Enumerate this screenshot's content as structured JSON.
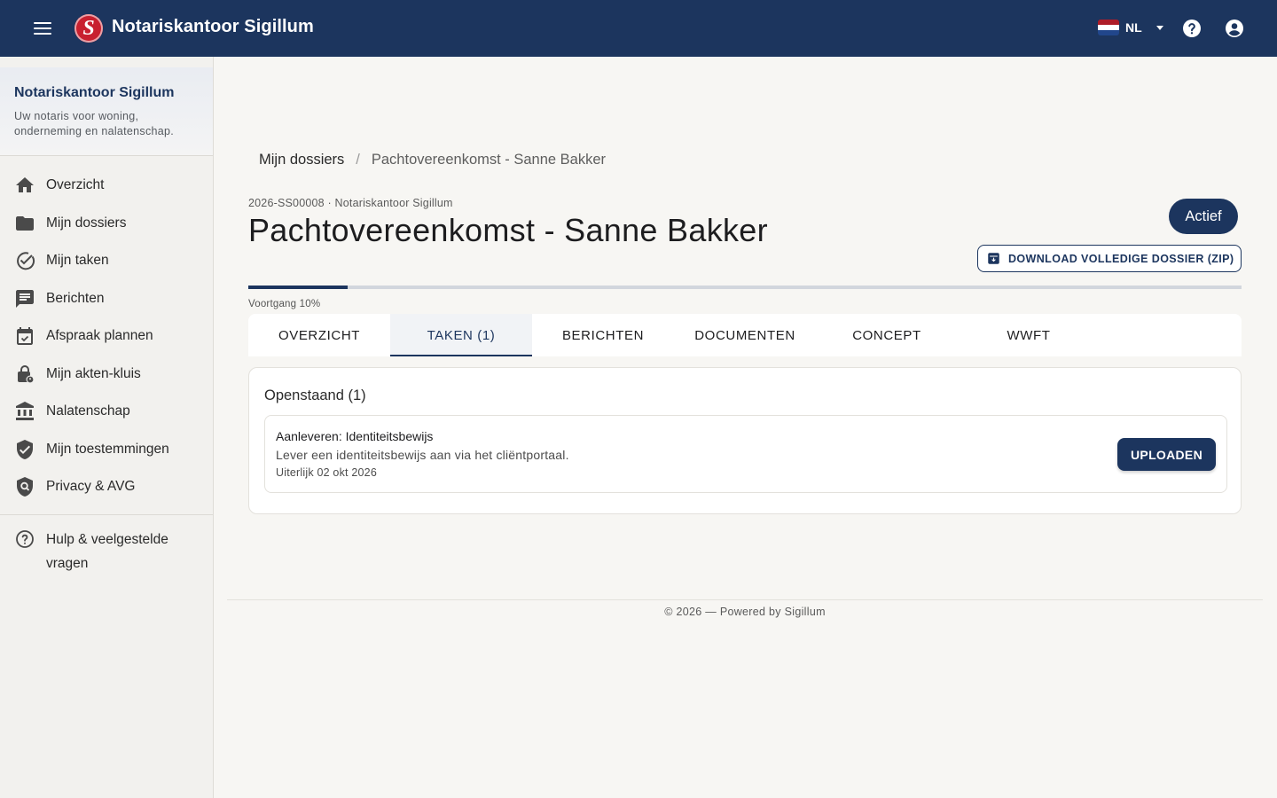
{
  "header": {
    "title": "Notariskantoor Sigillum",
    "logo_letter": "S",
    "language": "NL",
    "icons": [
      "menu-icon",
      "help-icon",
      "account-icon"
    ]
  },
  "sidebar": {
    "firm_name": "Notariskantoor Sigillum",
    "tagline": "Uw notaris voor woning, onderneming en nalatenschap.",
    "items": [
      {
        "label": "Overzicht",
        "icon": "home-icon"
      },
      {
        "label": "Mijn dossiers",
        "icon": "folder-icon"
      },
      {
        "label": "Mijn taken",
        "icon": "check-circle-icon"
      },
      {
        "label": "Berichten",
        "icon": "message-icon"
      },
      {
        "label": "Afspraak plannen",
        "icon": "calendar-check-icon"
      },
      {
        "label": "Mijn akten-kluis",
        "icon": "lock-icon"
      },
      {
        "label": "Nalatenschap",
        "icon": "bank-icon"
      },
      {
        "label": "Mijn toestemmingen",
        "icon": "shield-check-icon"
      },
      {
        "label": "Privacy & AVG",
        "icon": "shield-search-icon"
      }
    ],
    "help_label": "Hulp & veelgestelde vragen"
  },
  "breadcrumb": {
    "parent": "Mijn dossiers",
    "separator": "/",
    "current": "Pachtovereenkomst - Sanne Bakker"
  },
  "case": {
    "meta": "2026-SS00008 · Notariskantoor Sigillum",
    "title": "Pachtovereenkomst - Sanne Bakker",
    "status": "Actief",
    "download_label": "DOWNLOAD VOLLEDIGE DOSSIER (ZIP)",
    "progress_label": "Voortgang 10%",
    "progress_fraction": 0.1
  },
  "tabs": [
    {
      "label": "OVERZICHT",
      "active": false
    },
    {
      "label": "TAKEN (1)",
      "active": true
    },
    {
      "label": "BERICHTEN",
      "active": false
    },
    {
      "label": "DOCUMENTEN",
      "active": false
    },
    {
      "label": "CONCEPT",
      "active": false
    },
    {
      "label": "WWFT",
      "active": false
    }
  ],
  "tasks": {
    "section_title": "Openstaand (1)",
    "items": [
      {
        "title": "Aanleveren: Identiteitsbewijs",
        "description": "Lever een identiteitsbewijs aan via het cliëntportaal.",
        "due": "Uiterlijk 02 okt 2026",
        "action_label": "UPLOADEN"
      }
    ]
  },
  "footer": {
    "text": "© 2026 — Powered by Sigillum"
  },
  "colors": {
    "primary": "#1c355e",
    "logo_red": "#c8202f",
    "background": "#f7f6f3"
  }
}
